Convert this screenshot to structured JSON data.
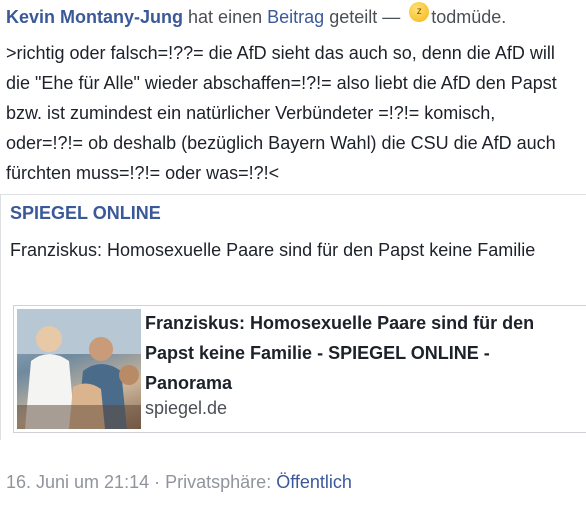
{
  "post": {
    "author": "Kevin Montany-Jung",
    "action_prefix": "hat einen",
    "action_link": "Beitrag",
    "action_suffix": "geteilt —",
    "feeling": "todmüde.",
    "feeling_icon": "sleepy-emoji-icon",
    "text": ">richtig oder falsch=!??= die AfD sieht das auch so, denn die AfD will die \"Ehe für Alle\" wieder abschaffen=!?!= also liebt die AfD den Papst bzw. ist zumindest ein natürlicher Verbündeter =!?!= komisch, oder=!?!= ob deshalb (bezüglich Bayern Wahl) die CSU die AfD auch fürchten muss=!?!= oder was=!?!<"
  },
  "shared": {
    "source": "SPIEGEL ONLINE",
    "headline": "Franziskus: Homosexuelle Paare sind für den Papst keine Familie",
    "link_title": "Franziskus: Homosexuelle Paare sind für den Papst keine Familie - SPIEGEL ONLINE - Panorama",
    "domain": "spiegel.de"
  },
  "footer": {
    "timestamp": "16. Juni um 21:14",
    "separator": "·",
    "privacy_label": "Privatsphäre:",
    "privacy_value": "Öffentlich"
  },
  "colors": {
    "link": "#3b5998",
    "text": "#1d2129",
    "muted": "#90949c"
  }
}
